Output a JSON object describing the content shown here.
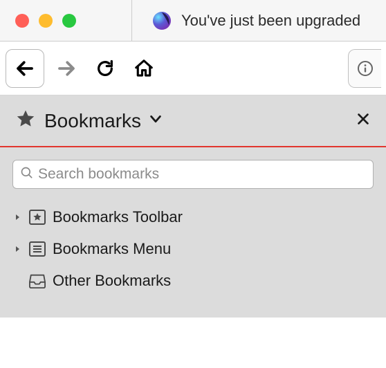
{
  "tab": {
    "title": "You've just been upgraded"
  },
  "sidebar": {
    "title": "Bookmarks",
    "search_placeholder": "Search bookmarks",
    "items": [
      {
        "label": "Bookmarks Toolbar"
      },
      {
        "label": "Bookmarks Menu"
      },
      {
        "label": "Other Bookmarks"
      }
    ]
  }
}
